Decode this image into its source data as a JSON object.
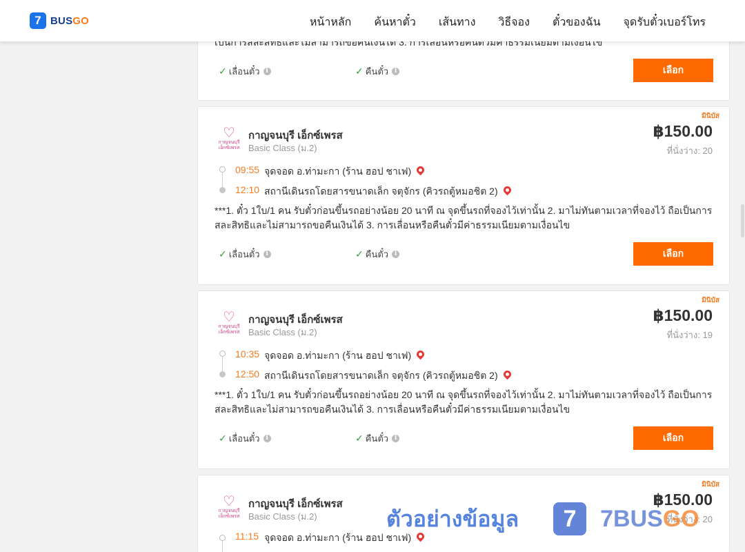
{
  "nav": {
    "brand_number": "7",
    "brand_main": "BUS",
    "brand_accent": "GO",
    "items": [
      "หน้าหลัก",
      "ค้นหาตั๋ว",
      "เส้นทาง",
      "วิธีจอง",
      "ตั๋วของฉัน",
      "จุดรับตั๋วเบอร์โทร"
    ]
  },
  "top_card": {
    "note_tail": "เป็นการสละสิทธิและไม่สามารถขอคืนเงินได้ 3. การเลื่อนหรือคืนตั๋วมีค่าธรรมเนียมตามเงื่อนไข",
    "change_label": "เลื่อนตั๋ว",
    "refund_label": "คืนตั๋ว",
    "select_label": "เลือก"
  },
  "trips": [
    {
      "tag": "มินิบัส",
      "operator": "กาญจนบุรี เอ็กซ์เพรส",
      "bus_class": "Basic Class (ม.2)",
      "price": "฿150.00",
      "seats": "ที่นั่งว่าง: 20",
      "depart_time": "09:55",
      "depart_place": "จุดจอด อ.ท่ามะกา (ร้าน ฮอป ชาเฟ)",
      "arrive_time": "12:10",
      "arrive_place": "สถานีเดินรถโดยสารขนาดเล็ก จตุจักร (คิวรถตู้หมอชิต 2)",
      "note": "***1. ตั๋ว 1ใบ/1 คน รับตั๋วก่อนขึ้นรถอย่างน้อย 20 นาที ณ จุดขึ้นรถที่จองไว้เท่านั้น 2. มาไม่ทันตามเวลาที่จองไว้ ถือเป็นการสละสิทธิและไม่สามารถขอคืนเงินได้ 3. การเลื่อนหรือคืนตั๋วมีค่าธรรมเนียมตามเงื่อนไข",
      "change_label": "เลื่อนตั๋ว",
      "refund_label": "คืนตั๋ว",
      "select_label": "เลือก"
    },
    {
      "tag": "มินิบัส",
      "operator": "กาญจนบุรี เอ็กซ์เพรส",
      "bus_class": "Basic Class (ม.2)",
      "price": "฿150.00",
      "seats": "ที่นั่งว่าง: 19",
      "depart_time": "10:35",
      "depart_place": "จุดจอด อ.ท่ามะกา (ร้าน ฮอป ชาเฟ)",
      "arrive_time": "12:50",
      "arrive_place": "สถานีเดินรถโดยสารขนาดเล็ก จตุจักร (คิวรถตู้หมอชิต 2)",
      "note": "***1. ตั๋ว 1ใบ/1 คน รับตั๋วก่อนขึ้นรถอย่างน้อย 20 นาที ณ จุดขึ้นรถที่จองไว้เท่านั้น 2. มาไม่ทันตามเวลาที่จองไว้ ถือเป็นการสละสิทธิและไม่สามารถขอคืนเงินได้ 3. การเลื่อนหรือคืนตั๋วมีค่าธรรมเนียมตามเงื่อนไข",
      "change_label": "เลื่อนตั๋ว",
      "refund_label": "คืนตั๋ว",
      "select_label": "เลือก"
    },
    {
      "tag": "มินิบัส",
      "operator": "กาญจนบุรี เอ็กซ์เพรส",
      "bus_class": "Basic Class (ม.2)",
      "price": "฿150.00",
      "seats": "ที่นั่งว่าง: 20",
      "depart_time": "11:15",
      "depart_place": "จุดจอด อ.ท่ามะกา (ร้าน ฮอป ชาเฟ)"
    }
  ],
  "logo_text": "กาญจนบุรี เอ็กซ์เพรส",
  "watermark": {
    "text": "ตัวอย่างข้อมูล",
    "logo_number": "7",
    "brand_main": "7BUS",
    "brand_accent": "GO"
  },
  "colors": {
    "accent": "#ff6a00",
    "time": "#f47b20",
    "check": "#2e9f3b",
    "pin": "#e53935"
  }
}
